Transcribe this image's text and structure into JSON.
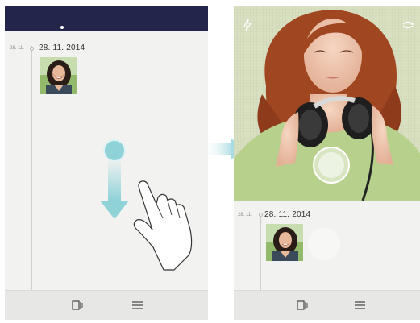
{
  "left_screen": {
    "timeline": {
      "small_date": "28. 11.",
      "date": "28. 11. 2014"
    },
    "bottom_bar": {
      "icons": [
        "gallery-icon",
        "menu-icon"
      ]
    }
  },
  "right_screen": {
    "top_icons": [
      "flash-icon",
      "switch-camera-icon"
    ],
    "timeline": {
      "small_date": "28. 11.",
      "date": "28. 11. 2014"
    },
    "bottom_bar": {
      "icons": [
        "gallery-icon",
        "menu-icon"
      ]
    }
  },
  "colors": {
    "status_bar": "#23254a",
    "screen_bg": "#f2f2f0",
    "gesture_accent": "#8fd2d8",
    "arrow_between": "#bfe6ea",
    "hero_bg": "#d7dfbf",
    "shirt": "#b7d08c",
    "hair": "#a04722"
  }
}
